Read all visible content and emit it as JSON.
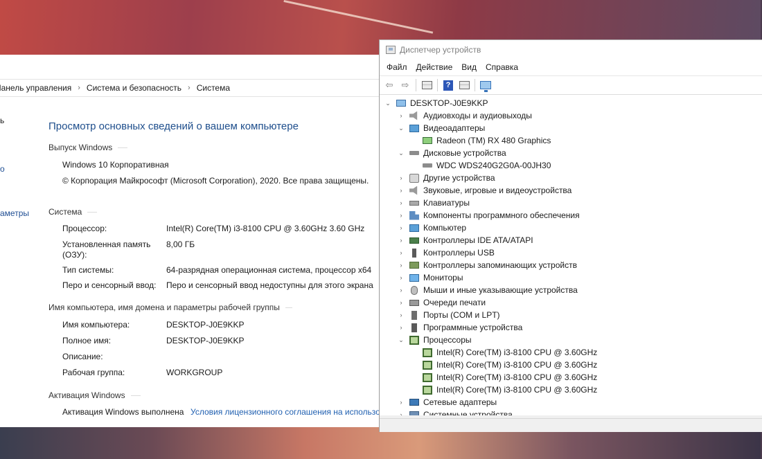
{
  "system_window": {
    "breadcrumb": [
      "Панель управления",
      "Система и безопасность",
      "Система"
    ],
    "sidebar_fragments": [
      "ь",
      "о",
      "аметры"
    ],
    "title": "Просмотр основных сведений о вашем компьютере",
    "edition": {
      "header": "Выпуск Windows",
      "name": "Windows 10 Корпоративная",
      "copyright": "© Корпорация Майкрософт (Microsoft Corporation), 2020. Все права защищены."
    },
    "system": {
      "header": "Система",
      "rows": [
        {
          "label": "Процессор:",
          "value": "Intel(R) Core(TM) i3-8100 CPU @ 3.60GHz   3.60 GHz"
        },
        {
          "label": "Установленная память\n(ОЗУ):",
          "value": "8,00 ГБ"
        },
        {
          "label": "Тип системы:",
          "value": "64-разрядная операционная система, процессор x64"
        },
        {
          "label": "Перо и сенсорный ввод:",
          "value": "Перо и сенсорный ввод недоступны для этого экрана"
        }
      ]
    },
    "computer_name": {
      "header": "Имя компьютера, имя домена и параметры рабочей группы",
      "rows": [
        {
          "label": "Имя компьютера:",
          "value": "DESKTOP-J0E9KKP"
        },
        {
          "label": "Полное имя:",
          "value": "DESKTOP-J0E9KKP"
        },
        {
          "label": "Описание:",
          "value": ""
        },
        {
          "label": "Рабочая группа:",
          "value": "WORKGROUP"
        }
      ]
    },
    "activation": {
      "header": "Активация Windows",
      "status": "Активация Windows выполнена",
      "license_link": "Условия лицензионного соглашения на использо"
    }
  },
  "device_manager": {
    "title": "Диспетчер устройств",
    "menu": [
      "Файл",
      "Действие",
      "Вид",
      "Справка"
    ],
    "toolbar_icons": [
      "back-arrow-icon",
      "forward-arrow-icon",
      "properties-grid-icon",
      "help-icon",
      "update-driver-icon",
      "scan-hardware-icon"
    ],
    "tree": {
      "root": "DESKTOP-J0E9KKP",
      "categories": [
        {
          "label": "Аудиовходы и аудиовыходы",
          "icon": "speaker-icon",
          "expanded": false,
          "children": []
        },
        {
          "label": "Видеоадаптеры",
          "icon": "display-adapter-icon",
          "expanded": true,
          "children": [
            "Radeon (TM) RX 480 Graphics"
          ]
        },
        {
          "label": "Дисковые устройства",
          "icon": "disk-icon",
          "expanded": true,
          "children": [
            "WDC WDS240G2G0A-00JH30"
          ]
        },
        {
          "label": "Другие устройства",
          "icon": "unknown-device-icon",
          "expanded": false,
          "children": []
        },
        {
          "label": "Звуковые, игровые и видеоустройства",
          "icon": "speaker-icon",
          "expanded": false,
          "children": []
        },
        {
          "label": "Клавиатуры",
          "icon": "keyboard-icon",
          "expanded": false,
          "children": []
        },
        {
          "label": "Компоненты программного обеспечения",
          "icon": "software-components-icon",
          "expanded": false,
          "children": []
        },
        {
          "label": "Компьютер",
          "icon": "computer-icon",
          "expanded": false,
          "children": []
        },
        {
          "label": "Контроллеры IDE ATA/ATAPI",
          "icon": "ide-controller-icon",
          "expanded": false,
          "children": []
        },
        {
          "label": "Контроллеры USB",
          "icon": "usb-icon",
          "expanded": false,
          "children": []
        },
        {
          "label": "Контроллеры запоминающих устройств",
          "icon": "storage-controller-icon",
          "expanded": false,
          "children": []
        },
        {
          "label": "Мониторы",
          "icon": "monitor-icon",
          "expanded": false,
          "children": []
        },
        {
          "label": "Мыши и иные указывающие устройства",
          "icon": "mouse-icon",
          "expanded": false,
          "children": []
        },
        {
          "label": "Очереди печати",
          "icon": "printer-icon",
          "expanded": false,
          "children": []
        },
        {
          "label": "Порты (COM и LPT)",
          "icon": "port-icon",
          "expanded": false,
          "children": []
        },
        {
          "label": "Программные устройства",
          "icon": "software-device-icon",
          "expanded": false,
          "children": []
        },
        {
          "label": "Процессоры",
          "icon": "cpu-icon",
          "expanded": true,
          "children": [
            "Intel(R) Core(TM) i3-8100 CPU @ 3.60GHz",
            "Intel(R) Core(TM) i3-8100 CPU @ 3.60GHz",
            "Intel(R) Core(TM) i3-8100 CPU @ 3.60GHz",
            "Intel(R) Core(TM) i3-8100 CPU @ 3.60GHz"
          ]
        },
        {
          "label": "Сетевые адаптеры",
          "icon": "network-adapter-icon",
          "expanded": false,
          "children": []
        },
        {
          "label": "Системные устройства",
          "icon": "system-devices-icon",
          "expanded": false,
          "children": []
        }
      ]
    }
  }
}
